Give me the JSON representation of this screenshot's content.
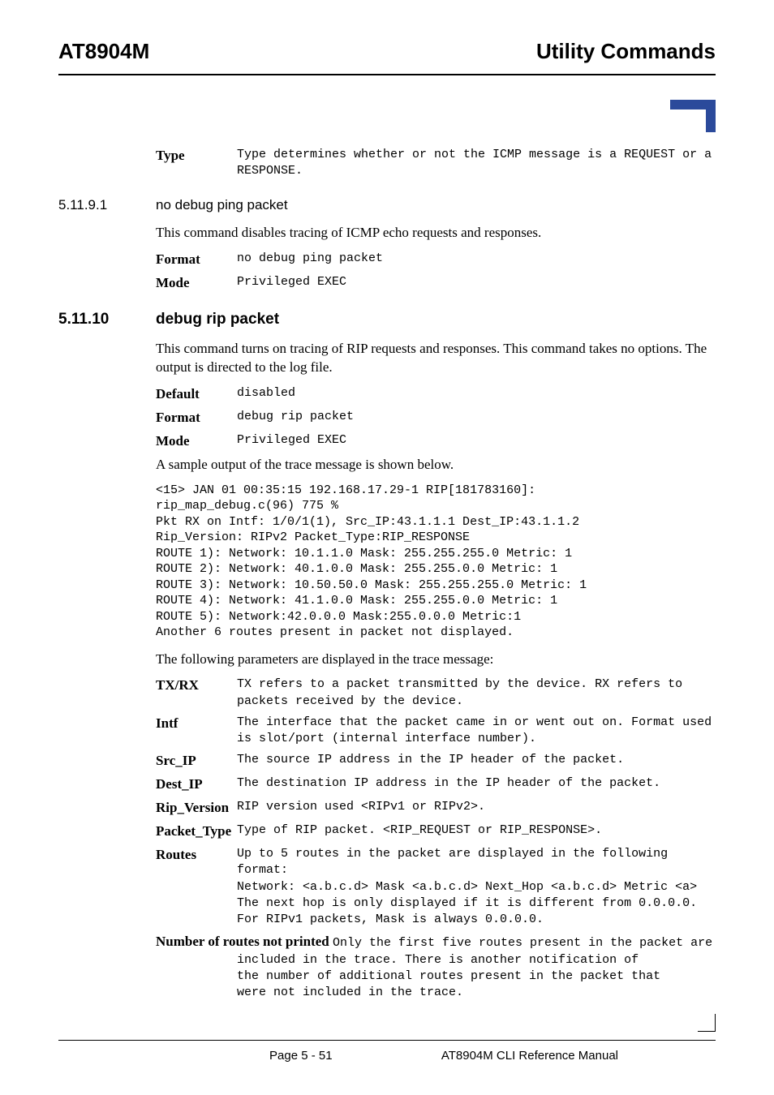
{
  "header": {
    "left": "AT8904M",
    "right": "Utility Commands"
  },
  "type_row": {
    "label": "Type",
    "value": "Type determines whether or not the ICMP message is a REQUEST or a RESPONSE."
  },
  "s51191": {
    "num": "5.11.9.1",
    "title": "no debug ping packet",
    "intro": "This command disables tracing of ICMP echo requests and responses.",
    "rows": [
      {
        "label": "Format",
        "value": "no debug ping packet"
      },
      {
        "label": "Mode",
        "value": "Privileged EXEC"
      }
    ]
  },
  "s51110": {
    "num": "5.11.10",
    "title": "debug rip packet",
    "intro": "This command turns on tracing of RIP requests and responses. This command takes no options. The output is directed to the log file.",
    "rows": [
      {
        "label": "Default",
        "value": "disabled"
      },
      {
        "label": "Format",
        "value": "debug rip packet"
      },
      {
        "label": "Mode",
        "value": "Privileged EXEC"
      }
    ],
    "sample_intro": "A sample output of the trace message is shown below.",
    "sample": "<15> JAN 01 00:35:15 192.168.17.29-1 RIP[181783160]:\nrip_map_debug.c(96) 775 %\nPkt RX on Intf: 1/0/1(1), Src_IP:43.1.1.1 Dest_IP:43.1.1.2\nRip_Version: RIPv2 Packet_Type:RIP_RESPONSE\nROUTE 1): Network: 10.1.1.0 Mask: 255.255.255.0 Metric: 1\nROUTE 2): Network: 40.1.0.0 Mask: 255.255.0.0 Metric: 1\nROUTE 3): Network: 10.50.50.0 Mask: 255.255.255.0 Metric: 1\nROUTE 4): Network: 41.1.0.0 Mask: 255.255.0.0 Metric: 1\nROUTE 5): Network:42.0.0.0 Mask:255.0.0.0 Metric:1\nAnother 6 routes present in packet not displayed.",
    "params_intro": "The following parameters are displayed in the trace message:",
    "params": [
      {
        "label": "TX/RX",
        "value": "TX refers to a packet transmitted by the device. RX refers to packets received by the device."
      },
      {
        "label": "Intf",
        "value": "The interface that the packet came in or went out on. Format used is slot/port (internal interface number)."
      },
      {
        "label": "Src_IP",
        "value": "The source IP address in the IP header of the packet."
      },
      {
        "label": "Dest_IP",
        "value": "The destination IP address in the IP header of the packet."
      },
      {
        "label": "Rip_Version",
        "value": "RIP version used <RIPv1 or RIPv2>."
      },
      {
        "label": "Packet_Type",
        "value": "Type of RIP packet. <RIP_REQUEST or RIP_RESPONSE>."
      },
      {
        "label": "Routes",
        "value": "Up to 5 routes in the packet are displayed in the following format:\nNetwork: <a.b.c.d> Mask <a.b.c.d> Next_Hop <a.b.c.d> Metric <a>\nThe next hop is only displayed if it is different from 0.0.0.0.\nFor RIPv1 packets, Mask is always 0.0.0.0."
      }
    ],
    "last_param": {
      "label": "Number of routes not printed",
      "value": "Only the first five routes present in the packet are included in the trace. There is another notification of the number of additional routes present in the packet that were not included in the trace."
    }
  },
  "footer": {
    "page": "Page 5 - 51",
    "doc": "AT8904M CLI Reference Manual"
  }
}
